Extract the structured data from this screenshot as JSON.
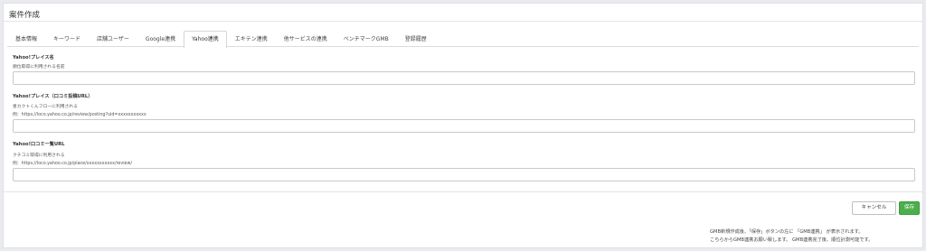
{
  "page": {
    "title": "案件作成"
  },
  "tabs": [
    {
      "label": "基本情報",
      "active": false
    },
    {
      "label": "キーワード",
      "active": false
    },
    {
      "label": "店舗ユーザー",
      "active": false
    },
    {
      "label": "Google連携",
      "active": false
    },
    {
      "label": "Yahoo連携",
      "active": true
    },
    {
      "label": "エキテン連携",
      "active": false
    },
    {
      "label": "他サービスの連携",
      "active": false
    },
    {
      "label": "ベンチマークGMB",
      "active": false
    },
    {
      "label": "登録履歴",
      "active": false
    }
  ],
  "fields": {
    "place_name": {
      "label": "Yahoo!プレイス名",
      "help": "順位取得に利用される名前",
      "value": ""
    },
    "place_url": {
      "label": "Yahoo!プレイス（口コミ投稿URL）",
      "help": "星カクトくんフローに利用される",
      "example": "例：https://loco.yahoo.co.jp/review/posting?uid=xxxxxxxxxxx",
      "value": ""
    },
    "review_list_url": {
      "label": "Yahoo!口コミ一覧URL",
      "help": "クチコミ取得に利用される",
      "example": "例：https://loco.yahoo.co.jp/place/xxxxxxxxxxx/review/",
      "value": ""
    }
  },
  "actions": {
    "cancel_label": "キャンセル",
    "save_label": "保存"
  },
  "notes": {
    "line1": "GMB新規作成後、「保存」ボタンの左に 「GMB連携」 が表示されます。",
    "line2": "こちらからGMB連携お願い致します。 GMB連携完了後、順位計測可能です。"
  },
  "colors": {
    "save_button": "#4cae4c",
    "background": "#e9ebee"
  }
}
